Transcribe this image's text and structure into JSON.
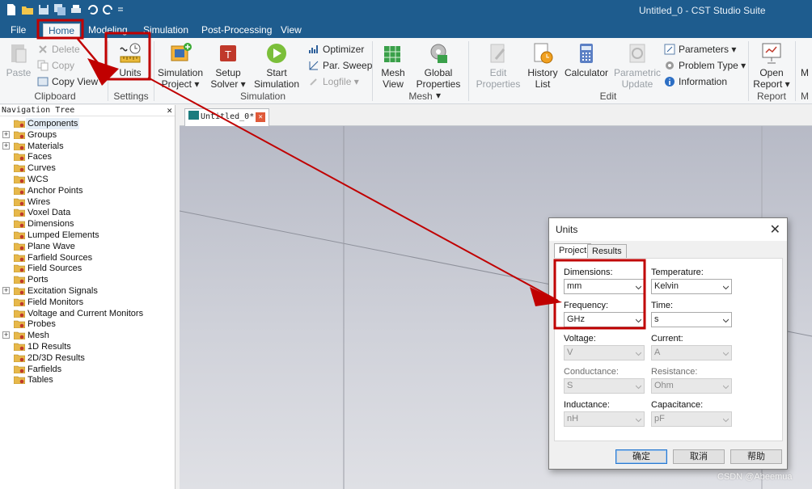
{
  "window": {
    "title": "Untitled_0 - CST Studio Suite"
  },
  "menu": {
    "tabs": [
      "File",
      "Home",
      "Modeling",
      "Simulation",
      "Post-Processing",
      "View"
    ],
    "active": "Home"
  },
  "ribbon": {
    "clipboard": {
      "paste": "Paste",
      "delete": "Delete",
      "copy": "Copy",
      "copy_view": "Copy View",
      "group": "Clipboard"
    },
    "settings": {
      "units": "Units",
      "group": "Settings"
    },
    "simulation": {
      "sim_project_1": "Simulation",
      "sim_project_2": "Project",
      "setup_1": "Setup",
      "setup_2": "Solver",
      "start_1": "Start",
      "start_2": "Simulation",
      "optimizer": "Optimizer",
      "par_sweep": "Par. Sweep",
      "logfile": "Logfile",
      "group": "Simulation"
    },
    "mesh": {
      "mesh_view_1": "Mesh",
      "mesh_view_2": "View",
      "global_1": "Global",
      "global_2": "Properties",
      "group": "Mesh"
    },
    "edit": {
      "edit_props_1": "Edit",
      "edit_props_2": "Properties",
      "history_1": "History",
      "history_2": "List",
      "calculator": "Calculator",
      "param_update_1": "Parametric",
      "param_update_2": "Update",
      "parameters": "Parameters",
      "problem_type": "Problem Type",
      "information": "Information",
      "group": "Edit"
    },
    "report": {
      "open_1": "Open",
      "open_2": "Report",
      "group": "Report"
    },
    "cut_m": "M"
  },
  "navtree": {
    "title": "Navigation Tree",
    "items": [
      {
        "label": "Components",
        "expandable": false
      },
      {
        "label": "Groups",
        "expandable": true
      },
      {
        "label": "Materials",
        "expandable": true
      },
      {
        "label": "Faces",
        "expandable": false
      },
      {
        "label": "Curves",
        "expandable": false
      },
      {
        "label": "WCS",
        "expandable": false
      },
      {
        "label": "Anchor Points",
        "expandable": false
      },
      {
        "label": "Wires",
        "expandable": false
      },
      {
        "label": "Voxel Data",
        "expandable": false
      },
      {
        "label": "Dimensions",
        "expandable": false
      },
      {
        "label": "Lumped Elements",
        "expandable": false
      },
      {
        "label": "Plane Wave",
        "expandable": false
      },
      {
        "label": "Farfield Sources",
        "expandable": false
      },
      {
        "label": "Field Sources",
        "expandable": false
      },
      {
        "label": "Ports",
        "expandable": false
      },
      {
        "label": "Excitation Signals",
        "expandable": true
      },
      {
        "label": "Field Monitors",
        "expandable": false
      },
      {
        "label": "Voltage and Current Monitors",
        "expandable": false
      },
      {
        "label": "Probes",
        "expandable": false
      },
      {
        "label": "Mesh",
        "expandable": true
      },
      {
        "label": "1D Results",
        "expandable": false
      },
      {
        "label": "2D/3D Results",
        "expandable": false
      },
      {
        "label": "Farfields",
        "expandable": false
      },
      {
        "label": "Tables",
        "expandable": false
      }
    ]
  },
  "document_tab": {
    "label": "Untitled_0*"
  },
  "units_dialog": {
    "title": "Units",
    "tabs": [
      "Project",
      "Results"
    ],
    "fields": {
      "dimensions": {
        "label": "Dimensions:",
        "value": "mm"
      },
      "temperature": {
        "label": "Temperature:",
        "value": "Kelvin"
      },
      "frequency": {
        "label": "Frequency:",
        "value": "GHz"
      },
      "time": {
        "label": "Time:",
        "value": "s"
      },
      "voltage": {
        "label": "Voltage:",
        "value": "V"
      },
      "current": {
        "label": "Current:",
        "value": "A"
      },
      "conductance": {
        "label": "Conductance:",
        "value": "S"
      },
      "resistance": {
        "label": "Resistance:",
        "value": "Ohm"
      },
      "inductance": {
        "label": "Inductance:",
        "value": "nH"
      },
      "capacitance": {
        "label": "Capacitance:",
        "value": "pF"
      }
    },
    "buttons": {
      "ok": "确定",
      "cancel": "取消",
      "help": "帮助"
    }
  },
  "watermark": "CSDN @Abeemua",
  "colors": {
    "titlebar": "#1e5c8e",
    "highlight": "#c00000"
  }
}
